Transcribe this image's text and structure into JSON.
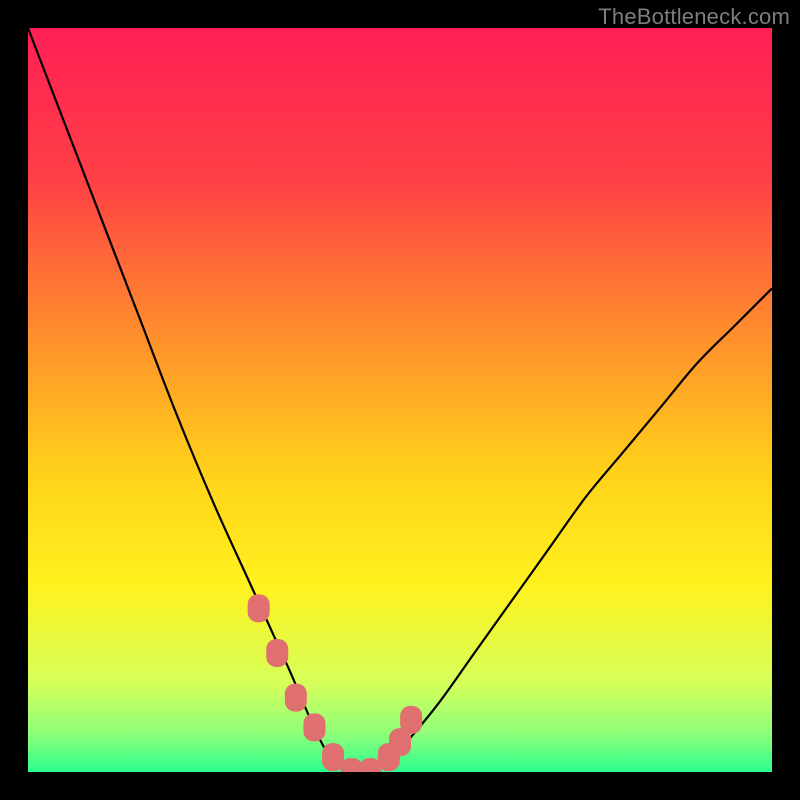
{
  "attribution": "TheBottleneck.com",
  "chart_data": {
    "type": "line",
    "title": "",
    "xlabel": "",
    "ylabel": "",
    "xlim": [
      0,
      100
    ],
    "ylim": [
      0,
      100
    ],
    "x": [
      0,
      5,
      10,
      15,
      20,
      25,
      30,
      35,
      38,
      40,
      42,
      44,
      46,
      48,
      50,
      55,
      60,
      65,
      70,
      75,
      80,
      85,
      90,
      95,
      100
    ],
    "values": [
      100,
      87,
      74,
      61,
      48,
      36,
      25,
      14,
      7,
      3,
      1,
      0,
      0,
      1,
      3,
      9,
      16,
      23,
      30,
      37,
      43,
      49,
      55,
      60,
      65
    ],
    "highlight_markers": {
      "x": [
        31,
        33.5,
        36,
        38.5,
        41,
        43.5,
        46,
        48.5,
        50,
        51.5
      ],
      "values": [
        22,
        16,
        10,
        6,
        2,
        0,
        0,
        2,
        4,
        7
      ]
    },
    "gradient_stops": [
      {
        "offset": 0,
        "color": "#ff1f55"
      },
      {
        "offset": 20,
        "color": "#ff3f46"
      },
      {
        "offset": 40,
        "color": "#ff8a2e"
      },
      {
        "offset": 60,
        "color": "#ffd21a"
      },
      {
        "offset": 75,
        "color": "#fff21e"
      },
      {
        "offset": 88,
        "color": "#d6ff5a"
      },
      {
        "offset": 95,
        "color": "#8cff7a"
      },
      {
        "offset": 100,
        "color": "#2bff8e"
      }
    ]
  }
}
